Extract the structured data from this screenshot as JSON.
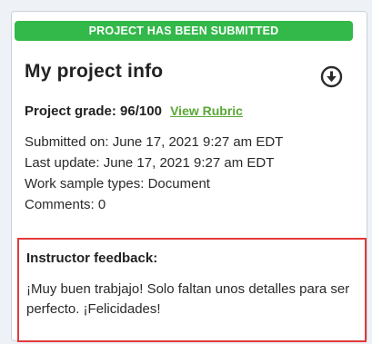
{
  "banner": {
    "text": "PROJECT HAS BEEN SUBMITTED",
    "color": "#33b84a"
  },
  "project_info": {
    "title": "My project info",
    "download_icon": "download-circle-icon",
    "grade_label": "Project grade: 96/100",
    "rubric_link": "View Rubric",
    "submitted_on": "Submitted on: June 17, 2021 9:27 am EDT",
    "last_update": "Last update: June 17, 2021 9:27 am EDT",
    "work_sample_types": "Work sample types: Document",
    "comments": "Comments: 0"
  },
  "feedback": {
    "title": "Instructor feedback:",
    "text": "¡Muy buen trabjajo! Solo faltan unos detalles para ser perfecto.  ¡Felicidades!",
    "highlight_color": "#e23a3a"
  },
  "colors": {
    "link": "#5aa836",
    "text": "#222222"
  }
}
